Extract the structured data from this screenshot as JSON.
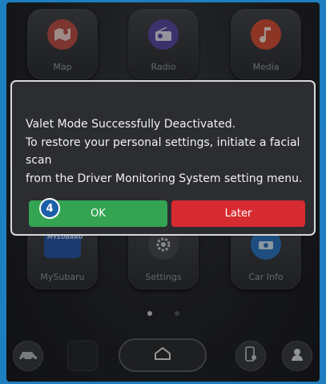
{
  "apps": {
    "map": "Map",
    "radio": "Radio",
    "media": "Media",
    "mysubaru": "MySubaru",
    "settings": "Settings",
    "car_info": "Car Info",
    "mysubaru_logo": "MYSUBARU"
  },
  "dialog": {
    "line1": "Valet Mode Successfully Deactivated.",
    "line2": "To restore your personal settings, initiate a facial scan",
    "line3": "from the Driver Monitoring System setting menu.",
    "ok_label": "OK",
    "later_label": "Later"
  },
  "step_badge": "4",
  "colors": {
    "ok": "#34a452",
    "later": "#d62b30",
    "map_icon": "#c0524b",
    "radio_icon": "#5b4ea6",
    "media_icon": "#d9533a",
    "car_info_icon": "#2f78c4",
    "frame": "#1d7fc0"
  },
  "pager": {
    "pages": 2,
    "active": 1
  },
  "icons": [
    "map-icon",
    "radio-icon",
    "music-note-icon",
    "mysubaru-icon",
    "gear-icon",
    "car-info-icon",
    "car-icon",
    "home-icon",
    "phone-settings-icon",
    "profile-icon"
  ]
}
